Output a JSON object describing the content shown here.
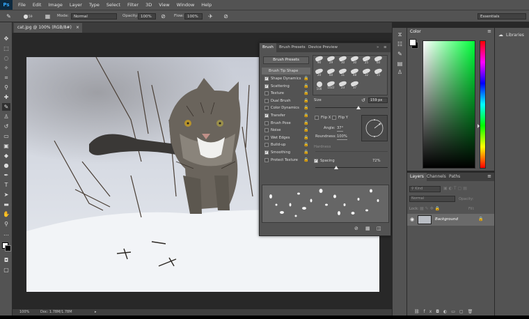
{
  "app": {
    "logo": "Ps"
  },
  "menu": [
    "File",
    "Edit",
    "Image",
    "Layer",
    "Type",
    "Select",
    "Filter",
    "3D",
    "View",
    "Window",
    "Help"
  ],
  "options": {
    "brush_size": "159",
    "mode_label": "Mode:",
    "mode_value": "Normal",
    "opacity_label": "Opacity:",
    "opacity_value": "100%",
    "flow_label": "Flow:",
    "flow_value": "100%",
    "workspace": "Essentials"
  },
  "document": {
    "tab_title": "cat.jpg @ 100% (RGB/8#)",
    "zoom": "100%",
    "doc_info": "Doc: 1.78M/1.78M"
  },
  "brush_panel": {
    "tabs": [
      "Brush",
      "Brush Presets",
      "Device Preview"
    ],
    "presets_button": "Brush Presets",
    "tip_shape_label": "Brush Tip Shape",
    "settings": [
      {
        "label": "Shape Dynamics",
        "checked": true
      },
      {
        "label": "Scattering",
        "checked": true
      },
      {
        "label": "Texture",
        "checked": false
      },
      {
        "label": "Dual Brush",
        "checked": false
      },
      {
        "label": "Color Dynamics",
        "checked": false
      },
      {
        "label": "Transfer",
        "checked": true
      },
      {
        "label": "Brush Pose",
        "checked": false
      },
      {
        "label": "Noise",
        "checked": false
      },
      {
        "label": "Wet Edges",
        "checked": false
      },
      {
        "label": "Build-up",
        "checked": false
      },
      {
        "label": "Smoothing",
        "checked": true
      },
      {
        "label": "Protect Texture",
        "checked": false
      }
    ],
    "tip_sizes": [
      "90",
      "29",
      "30",
      "30",
      "25",
      "60",
      "20",
      "60",
      "11",
      "48",
      "32",
      "55",
      "100",
      "1022",
      "23",
      "37"
    ],
    "size_label": "Size",
    "size_value": "159 px",
    "flip_x": "Flip X",
    "flip_y": "Flip Y",
    "angle_label": "Angle:",
    "angle_value": "37°",
    "roundness_label": "Roundness:",
    "roundness_value": "100%",
    "hardness_label": "Hardness",
    "spacing_label": "Spacing",
    "spacing_value": "72%",
    "spacing_fraction": 0.29,
    "size_fraction": 0.6
  },
  "color_panel": {
    "title": "Color",
    "foreground": "#ffffff",
    "background": "#000000"
  },
  "libraries": {
    "title": "Libraries"
  },
  "layers_panel": {
    "tabs": [
      "Layers",
      "Channels",
      "Paths"
    ],
    "kind_label": "Kind",
    "blend_mode": "Normal",
    "opacity_label": "Opacity:",
    "lock_label": "Lock:",
    "fill_label": "Fill:",
    "layer_name": "Background"
  },
  "colors": {
    "accent_green": "#00ff3a",
    "panel": "#535353",
    "dark": "#282828"
  }
}
